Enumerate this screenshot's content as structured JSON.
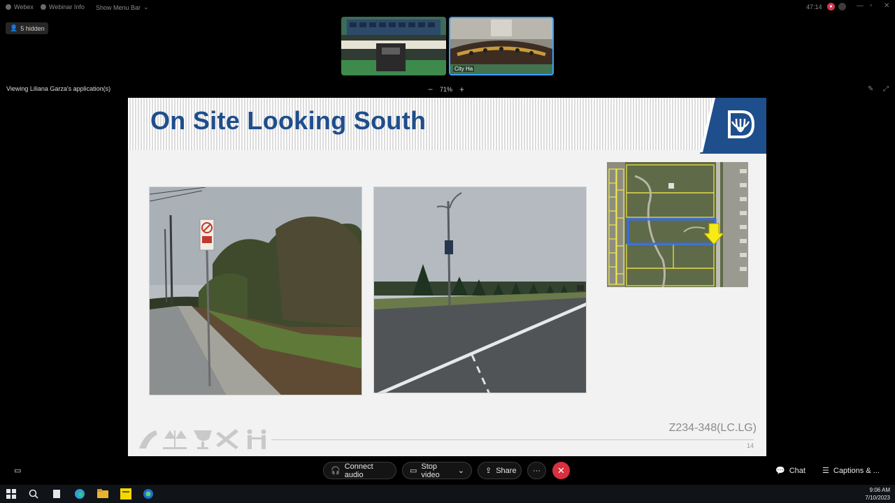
{
  "menubar": {
    "app_title": "Webex",
    "webinar_info": "Webinar Info",
    "show_menu_bar": "Show Menu Bar",
    "timer": "47:14"
  },
  "hidden_badge": "5 hidden",
  "thumbnails": [
    {
      "label": "",
      "selected": false
    },
    {
      "label": "City Ha",
      "selected": true
    }
  ],
  "viewing_text": "Viewing Liliana Garza's application(s)",
  "zoom": {
    "level": "71%",
    "minus": "−",
    "plus": "+"
  },
  "slide": {
    "title": "On Site Looking South",
    "case_id": "Z234-348(LC.LG)",
    "page_number": "14"
  },
  "controls": {
    "connect_audio": "Connect audio",
    "stop_video": "Stop video",
    "share": "Share",
    "more": "···",
    "end": "✕",
    "chat": "Chat",
    "captions": "Captions & ..."
  },
  "taskbar": {
    "time": "9:06 AM",
    "date": "7/10/2023"
  },
  "colors": {
    "title_blue": "#1f4e8c",
    "end_red": "#d8303f",
    "selected_border": "#3aa1ff"
  }
}
